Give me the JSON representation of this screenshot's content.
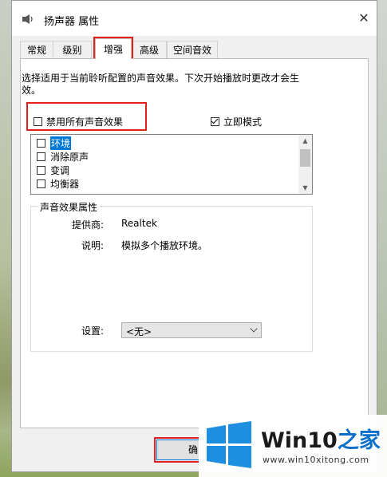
{
  "window": {
    "title": "扬声器 属性",
    "close_glyph": "✕"
  },
  "tabs": [
    {
      "label": "常规"
    },
    {
      "label": "级别"
    },
    {
      "label": "增强"
    },
    {
      "label": "高级"
    },
    {
      "label": "空间音效"
    }
  ],
  "active_tab": "增强",
  "enhancement": {
    "description": "选择适用于当前聆听配置的声音效果。下次开始播放时更改才会生效。",
    "disable_all_label": "禁用所有声音效果",
    "disable_all_checked": false,
    "immediate_mode_label": "立即模式",
    "immediate_mode_checked": true,
    "effects": [
      {
        "label": "环境",
        "checked": false,
        "selected": true
      },
      {
        "label": "消除原声",
        "checked": false,
        "selected": false
      },
      {
        "label": "变调",
        "checked": false,
        "selected": false
      },
      {
        "label": "均衡器",
        "checked": false,
        "selected": false
      }
    ],
    "properties": {
      "group_title": "声音效果属性",
      "provider_label": "提供商:",
      "provider_value": "Realtek",
      "description_label": "说明:",
      "description_value": "模拟多个播放环境。",
      "setting_label": "设置:",
      "setting_value": "<无>"
    }
  },
  "footer": {
    "ok_label": "确"
  },
  "watermark": {
    "brand_prefix": "Win10",
    "brand_suffix": "之家",
    "url": "www.win10xitong.com"
  },
  "colors": {
    "highlight_red": "#e3201b",
    "selection_blue": "#0078d7",
    "brand_blue": "#0a6fc9"
  }
}
